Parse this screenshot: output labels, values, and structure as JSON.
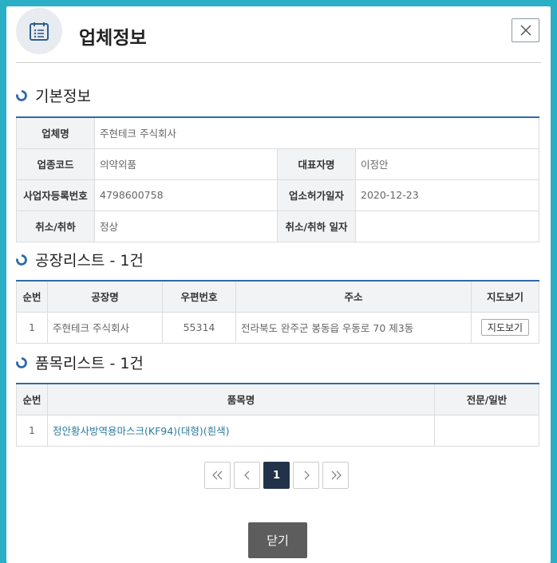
{
  "modal": {
    "title": "업체정보",
    "close_label": "닫기"
  },
  "basic": {
    "title": "기본정보",
    "rows": [
      {
        "label1": "업체명",
        "value1": "주현테크 주식회사"
      },
      {
        "label1": "업종코드",
        "value1": "의약외품",
        "label2": "대표자명",
        "value2": "이정안"
      },
      {
        "label1": "사업자등록번호",
        "value1": "4798600758",
        "label2": "업소허가일자",
        "value2": "2020-12-23"
      },
      {
        "label1": "취소/취하",
        "value1": "정상",
        "label2": "취소/취하 일자",
        "value2": ""
      }
    ]
  },
  "factories": {
    "title": "공장리스트 - 1건",
    "headers": [
      "순번",
      "공장명",
      "우편번호",
      "주소",
      "지도보기"
    ],
    "rows": [
      {
        "no": "1",
        "name": "주현테크 주식회사",
        "zip": "55314",
        "address": "전라북도 완주군 봉동읍 우동로 70 제3동",
        "map": "지도보기"
      }
    ]
  },
  "products": {
    "title": "품목리스트 - 1건",
    "headers": [
      "순번",
      "품목명",
      "전문/일반"
    ],
    "rows": [
      {
        "no": "1",
        "name": "정안황사방역용마스크(KF94)(대형)(흰색)",
        "type": ""
      }
    ]
  },
  "pagination": {
    "current": "1"
  },
  "colors": {
    "accent": "#2e6aa8",
    "frame": "#2aafc6",
    "active_page": "#22324b",
    "link": "#2b7a9e"
  },
  "icons": {
    "header": "calendar-list-icon",
    "close": "close-icon",
    "section": "refresh-ring-icon"
  }
}
